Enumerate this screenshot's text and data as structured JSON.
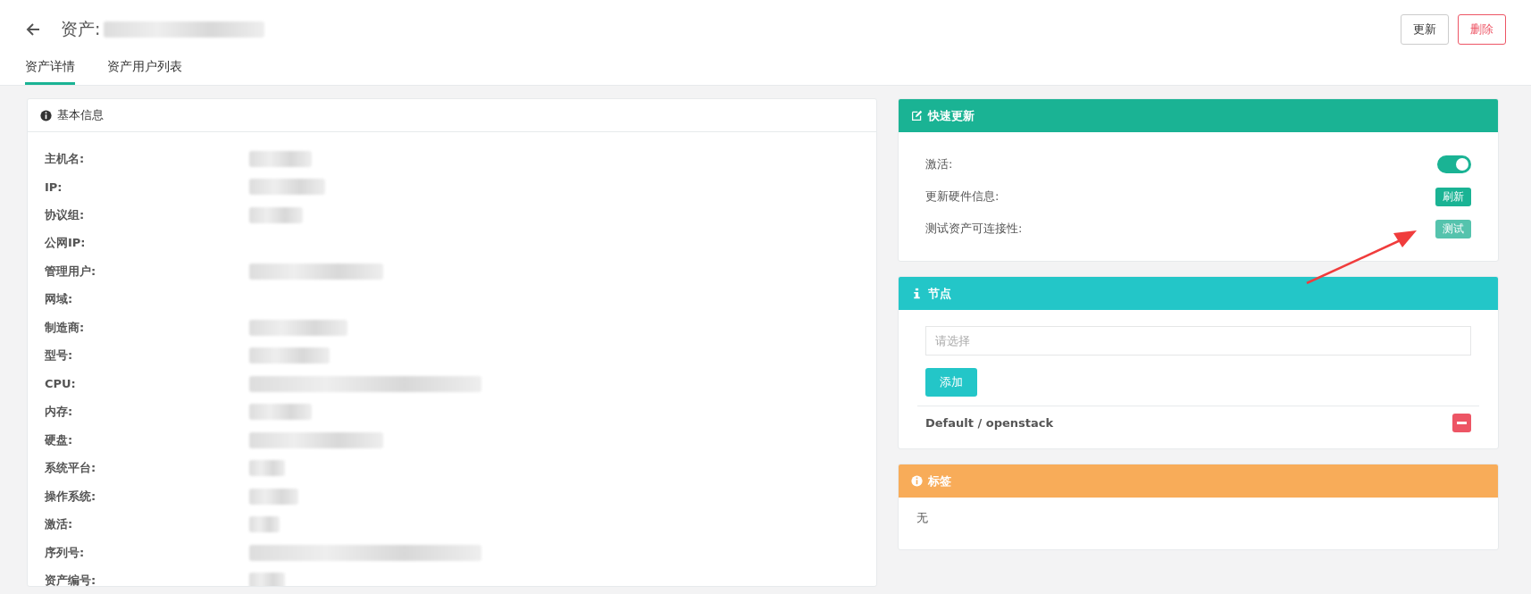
{
  "header": {
    "title": "资产:",
    "title_redacted": true,
    "tabs": [
      {
        "label": "资产详情",
        "selected": true
      },
      {
        "label": "资产用户列表",
        "selected": false
      }
    ],
    "buttons": [
      {
        "label": "更新",
        "kind": "default"
      },
      {
        "label": "删除",
        "kind": "danger"
      }
    ]
  },
  "basic_info": {
    "title": "基本信息",
    "rows": [
      {
        "label": "主机名:",
        "redacted": true
      },
      {
        "label": "IP:",
        "redacted": true
      },
      {
        "label": "协议组:",
        "redacted": true
      },
      {
        "label": "公网IP:",
        "redacted": false
      },
      {
        "label": "管理用户:",
        "redacted": true
      },
      {
        "label": "网域:",
        "redacted": false
      },
      {
        "label": "制造商:",
        "redacted": true
      },
      {
        "label": "型号:",
        "redacted": true
      },
      {
        "label": "CPU:",
        "redacted": true
      },
      {
        "label": "内存:",
        "redacted": true
      },
      {
        "label": "硬盘:",
        "redacted": true
      },
      {
        "label": "系统平台:",
        "redacted": true
      },
      {
        "label": "操作系统:",
        "redacted": true
      },
      {
        "label": "激活:",
        "redacted": true
      },
      {
        "label": "序列号:",
        "redacted": true
      },
      {
        "label": "资产编号:",
        "redacted": true
      }
    ]
  },
  "quick_update": {
    "title": "快速更新",
    "items": [
      {
        "kind": "toggle",
        "label": "激活:",
        "on": true
      },
      {
        "kind": "button",
        "label": "更新硬件信息:",
        "button": "刷新",
        "disabled": false
      },
      {
        "kind": "button",
        "label": "测试资产可连接性:",
        "button": "测试",
        "disabled": true
      }
    ]
  },
  "nodes": {
    "title": "节点",
    "select": {
      "placeholder": "请选择"
    },
    "add_button": "添加",
    "items": [
      {
        "name": "Default / openstack"
      }
    ]
  },
  "labels": {
    "title": "标签",
    "empty_text": "无"
  },
  "annotation": {
    "arrow": true
  }
}
